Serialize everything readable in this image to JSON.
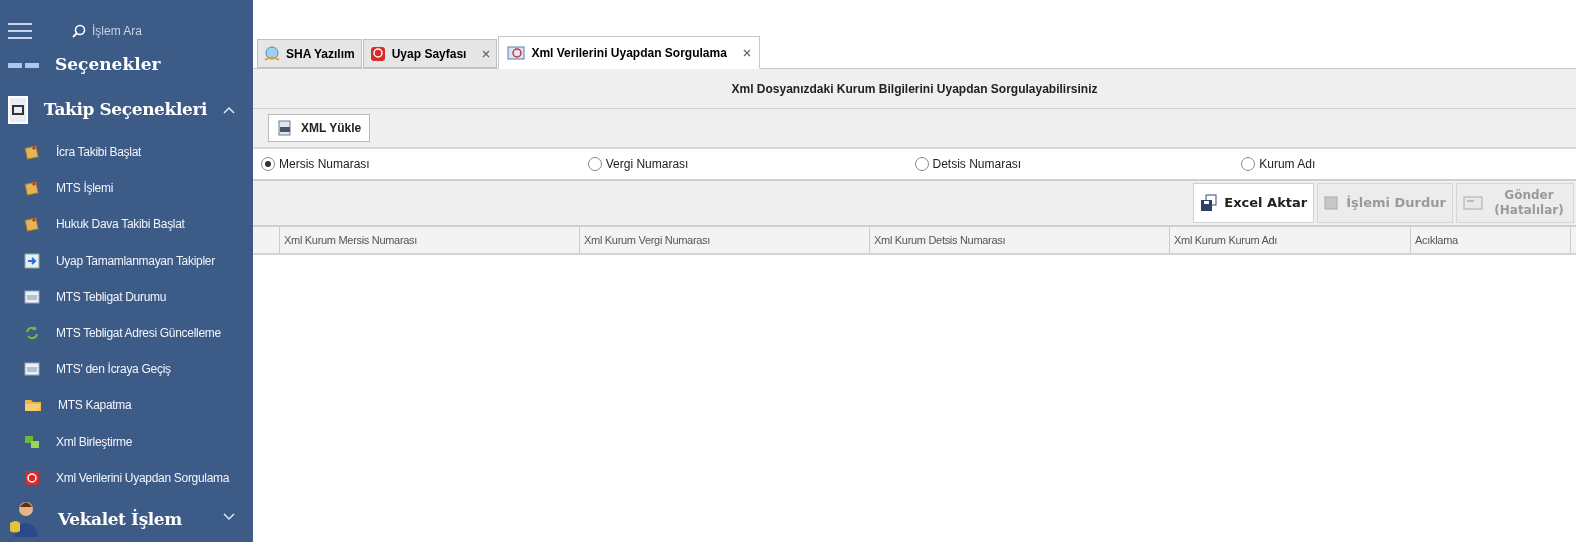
{
  "sidebar": {
    "search": {
      "placeholder": "İşlem Ara"
    },
    "sections": [
      {
        "title": "Seçenekler",
        "kind": "plain"
      },
      {
        "title": "Takip Seçenekleri",
        "kind": "group",
        "expanded": true,
        "items": [
          {
            "label": "İcra Takibi Başlat"
          },
          {
            "label": "MTS İşlemi"
          },
          {
            "label": "Hukuk Dava Takibi Başlat"
          },
          {
            "label": "Uyap Tamamlanmayan Takipler"
          },
          {
            "label": "MTS Tebligat Durumu"
          },
          {
            "label": "MTS Tebligat Adresi Güncelleme"
          },
          {
            "label": "MTS' den İcraya Geçiş"
          },
          {
            "label": "MTS Kapatma"
          },
          {
            "label": "Xml Birleştirme"
          },
          {
            "label": "Xml Verilerini Uyapdan Sorgulama"
          }
        ]
      },
      {
        "title": "Vekalet İşlem",
        "kind": "person",
        "expanded": false
      }
    ]
  },
  "tabs": [
    {
      "label": "SHA Yazılım",
      "selected": false
    },
    {
      "label": "Uyap Sayfası",
      "selected": false
    },
    {
      "label": "Xml Verilerini Uyapdan Sorgulama",
      "selected": true
    }
  ],
  "heading": "Xml Dosyanızdaki Kurum Bilgilerini Uyapdan Sorgulayabilirsiniz",
  "upload_button": "XML Yükle",
  "radios": [
    {
      "label": "Mersis Numarası",
      "selected": true
    },
    {
      "label": "Vergi Numarası",
      "selected": false
    },
    {
      "label": "Detsis Numarası",
      "selected": false
    },
    {
      "label": "Kurum Adı",
      "selected": false
    }
  ],
  "actions": [
    {
      "label": "Excel Aktar",
      "disabled": false
    },
    {
      "label": "İşlemi Durdur",
      "disabled": true
    },
    {
      "label": "Gönder (Hatalılar)",
      "disabled": true
    }
  ],
  "table": {
    "columns": [
      "Xml Kurum Mersis Numarası",
      "Xml Kurum Vergi Numarası",
      "Xml Kurum Detsis Numarası",
      "Xml Kurum Kurum Adı",
      "Acıklama"
    ]
  }
}
